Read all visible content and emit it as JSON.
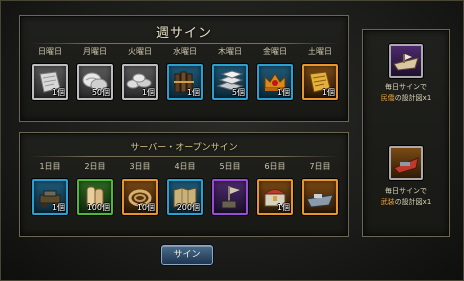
{
  "weekly": {
    "title": "週サイン",
    "days": [
      {
        "label": "日曜日",
        "qty": "1個",
        "quality": "white",
        "icon": "blueprint-scroll-icon"
      },
      {
        "label": "月曜日",
        "qty": "50個",
        "quality": "white",
        "icon": "cotton-bundle-icon"
      },
      {
        "label": "火曜日",
        "qty": "1個",
        "quality": "white",
        "icon": "stone-pile-icon"
      },
      {
        "label": "水曜日",
        "qty": "1個",
        "quality": "blue",
        "icon": "lumber-bundle-icon"
      },
      {
        "label": "木曜日",
        "qty": "5個",
        "quality": "blue",
        "icon": "iron-ingot-icon"
      },
      {
        "label": "金曜日",
        "qty": "1個",
        "quality": "blue",
        "icon": "crown-icon"
      },
      {
        "label": "土曜日",
        "qty": "1個",
        "quality": "orange",
        "icon": "gold-blueprint-icon"
      }
    ]
  },
  "server": {
    "title": "サーバー・オープンサイン",
    "days": [
      {
        "label": "1日目",
        "qty": "1個",
        "quality": "blue",
        "icon": "cannon-icon"
      },
      {
        "label": "2日目",
        "qty": "100個",
        "quality": "green",
        "icon": "scroll-bundle-icon"
      },
      {
        "label": "3日目",
        "qty": "10個",
        "quality": "orange",
        "icon": "rope-icon"
      },
      {
        "label": "4日目",
        "qty": "200個",
        "quality": "blue",
        "icon": "map-icon"
      },
      {
        "label": "5日目",
        "qty": "",
        "quality": "purple",
        "icon": "tower-flag-icon"
      },
      {
        "label": "6日目",
        "qty": "1個",
        "quality": "orange",
        "icon": "treasure-chest-icon"
      },
      {
        "label": "7日目",
        "qty": "",
        "quality": "orange",
        "icon": "warship-icon"
      }
    ]
  },
  "side_rewards": [
    {
      "line1": "毎日サインで",
      "highlight": "民僑",
      "line2": "の設計図x1",
      "quality": "purple",
      "icon": "merchant-ship-icon"
    },
    {
      "line1": "毎日サインで",
      "highlight": "武装",
      "line2": "の設計図x1",
      "quality": "orange",
      "icon": "armed-ship-icon"
    }
  ],
  "sign_button": "サイン"
}
